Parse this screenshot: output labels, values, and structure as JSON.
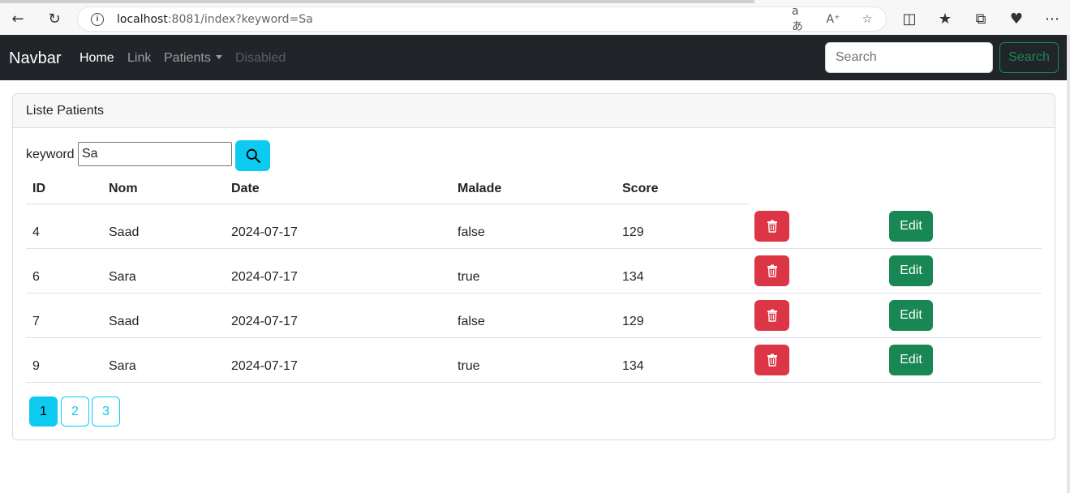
{
  "browser": {
    "url_host": "localhost",
    "url_rest": ":8081/index?keyword=Sa",
    "back_icon": "arrow-left-icon",
    "reload_icon": "reload-icon",
    "info_icon": "info-icon",
    "toolbar_icons": [
      "translate-icon",
      "read-aloud-icon",
      "favorite-icon",
      "split-screen-icon",
      "favorites-icon",
      "collections-icon",
      "performance-icon",
      "more-icon"
    ]
  },
  "navbar": {
    "brand": "Navbar",
    "links": {
      "home": "Home",
      "link": "Link",
      "patients": "Patients",
      "disabled": "Disabled"
    },
    "search_placeholder": "Search",
    "search_button": "Search"
  },
  "card": {
    "title": "Liste Patients",
    "keyword_label": "keyword",
    "keyword_value": "Sa"
  },
  "table": {
    "headers": {
      "id": "ID",
      "nom": "Nom",
      "date": "Date",
      "malade": "Malade",
      "score": "Score"
    },
    "rows": [
      {
        "id": "4",
        "nom": "Saad",
        "date": "2024-07-17",
        "malade": "false",
        "score": "129",
        "edit": "Edit"
      },
      {
        "id": "6",
        "nom": "Sara",
        "date": "2024-07-17",
        "malade": "true",
        "score": "134",
        "edit": "Edit"
      },
      {
        "id": "7",
        "nom": "Saad",
        "date": "2024-07-17",
        "malade": "false",
        "score": "129",
        "edit": "Edit"
      },
      {
        "id": "9",
        "nom": "Sara",
        "date": "2024-07-17",
        "malade": "true",
        "score": "134",
        "edit": "Edit"
      }
    ]
  },
  "pagination": {
    "pages": [
      "1",
      "2",
      "3"
    ],
    "current": "1"
  },
  "colors": {
    "navbar_bg": "#212529",
    "info": "#0dcaf0",
    "danger": "#dc3545",
    "success": "#198754"
  }
}
